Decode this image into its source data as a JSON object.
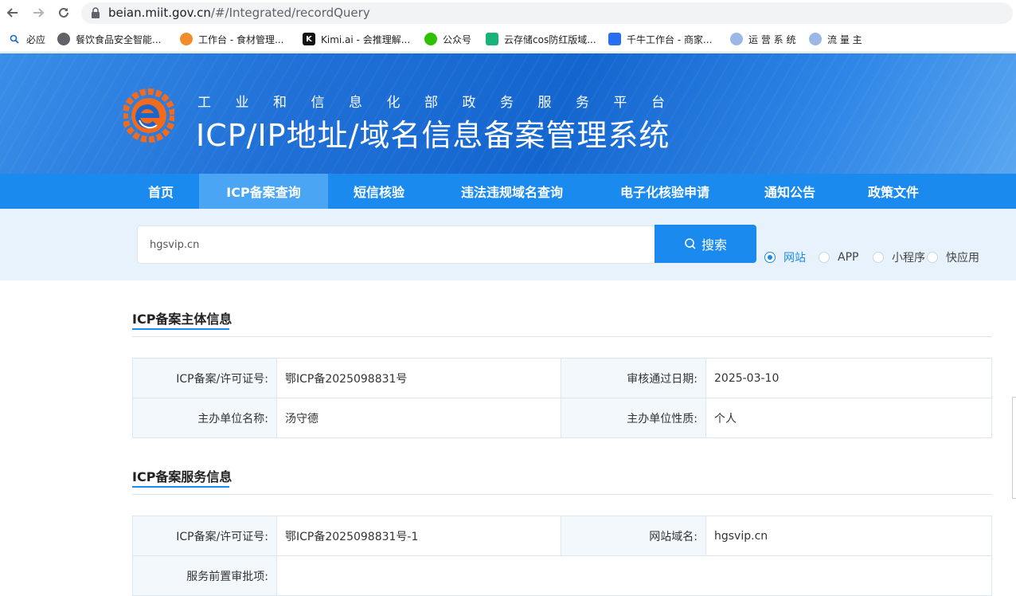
{
  "browser": {
    "url_host": "beian.miit.gov.cn",
    "url_path": "/#/Integrated/recordQuery",
    "bookmarks": [
      {
        "label": "必应",
        "icon": "search-icon"
      },
      {
        "label": "餐饮食品安全智能...",
        "icon": "globe-icon"
      },
      {
        "label": "工作台 - 食材管理...",
        "icon": "orange-logo-icon"
      },
      {
        "label": "Kimi.ai - 会推理解...",
        "icon": "kimi-icon"
      },
      {
        "label": "公众号",
        "icon": "wechat-icon"
      },
      {
        "label": "云存储cos防红版域...",
        "icon": "fox-icon"
      },
      {
        "label": "千牛工作台 - 商家...",
        "icon": "qianniu-icon"
      },
      {
        "label": "运 营 系 统",
        "icon": "user-icon"
      },
      {
        "label": "流 量 主",
        "icon": "user-icon"
      }
    ]
  },
  "banner": {
    "subtitle": "工业和信息化部政务服务平台",
    "title": "ICP/IP地址/域名信息备案管理系统"
  },
  "menu": [
    {
      "label": "首页",
      "active": false
    },
    {
      "label": "ICP备案查询",
      "active": true
    },
    {
      "label": "短信核验",
      "active": false
    },
    {
      "label": "违法违规域名查询",
      "active": false
    },
    {
      "label": "电子化核验申请",
      "active": false
    },
    {
      "label": "通知公告",
      "active": false
    },
    {
      "label": "政策文件",
      "active": false
    }
  ],
  "search": {
    "value": "hgsvip.cn",
    "button_label": "搜索",
    "options": [
      {
        "label": "网站",
        "checked": true
      },
      {
        "label": "APP",
        "checked": false
      },
      {
        "label": "小程序",
        "checked": false
      },
      {
        "label": "快应用",
        "checked": false
      }
    ]
  },
  "subject_info": {
    "title": "ICP备案主体信息",
    "rows": [
      {
        "label1": "ICP备案/许可证号:",
        "value1": "鄂ICP备2025098831号",
        "label2": "审核通过日期:",
        "value2": "2025-03-10"
      },
      {
        "label1": "主办单位名称:",
        "value1": "汤守德",
        "label2": "主办单位性质:",
        "value2": "个人"
      }
    ]
  },
  "service_info": {
    "title": "ICP备案服务信息",
    "rows": [
      {
        "label1": "ICP备案/许可证号:",
        "value1": "鄂ICP备2025098831号-1",
        "label2": "网站域名:",
        "value2": "hgsvip.cn"
      },
      {
        "label1": "服务前置审批项:",
        "value1": "",
        "label2": "",
        "value2": ""
      }
    ]
  },
  "colors": {
    "accent": "#1a8aee",
    "menu_active": "#4aa6f5",
    "search_band": "#e8f2fc"
  }
}
